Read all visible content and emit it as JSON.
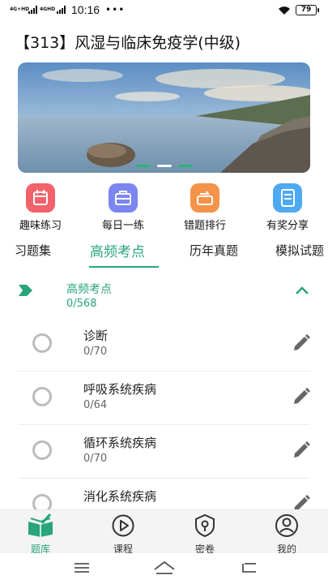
{
  "status_bar": {
    "network_1": "4G+HD",
    "network_2": "4GHD",
    "time": "10:16",
    "more": "•••",
    "battery": "79",
    "wifi_icon": "wifi-icon"
  },
  "header": {
    "title": "【313】风湿与临床免疫学(中级)"
  },
  "banner": {
    "image": "lake-landscape",
    "slide_count": 3,
    "active_slide": 2
  },
  "quick_actions": [
    {
      "label": "趣味练习",
      "icon": "calendar-icon",
      "color": "#f2626b"
    },
    {
      "label": "每日一练",
      "icon": "briefcase-icon",
      "color": "#7b86f0"
    },
    {
      "label": "错题排行",
      "icon": "ranking-icon",
      "color": "#f4934a"
    },
    {
      "label": "有奖分享",
      "icon": "notebook-icon",
      "color": "#4ea9f3"
    }
  ],
  "tabs": [
    {
      "label": "习题集",
      "active": false
    },
    {
      "label": "高频考点",
      "active": true
    },
    {
      "label": "历年真题",
      "active": false
    },
    {
      "label": "模拟试题",
      "active": false
    }
  ],
  "section": {
    "title": "高频考点",
    "count": "0/568"
  },
  "items": [
    {
      "name": "诊断",
      "count": "0/70"
    },
    {
      "name": "呼吸系统疾病",
      "count": "0/64"
    },
    {
      "name": "循环系统疾病",
      "count": "0/70"
    },
    {
      "name": "消化系统疾病",
      "count": ""
    }
  ],
  "bottom_nav": [
    {
      "label": "题库",
      "icon": "book-icon",
      "active": true
    },
    {
      "label": "课程",
      "icon": "play-icon",
      "active": false
    },
    {
      "label": "密卷",
      "icon": "lock-icon",
      "active": false
    },
    {
      "label": "我的",
      "icon": "user-icon",
      "active": false
    }
  ],
  "colors": {
    "accent": "#2aa57b",
    "divider": "#ececec"
  }
}
